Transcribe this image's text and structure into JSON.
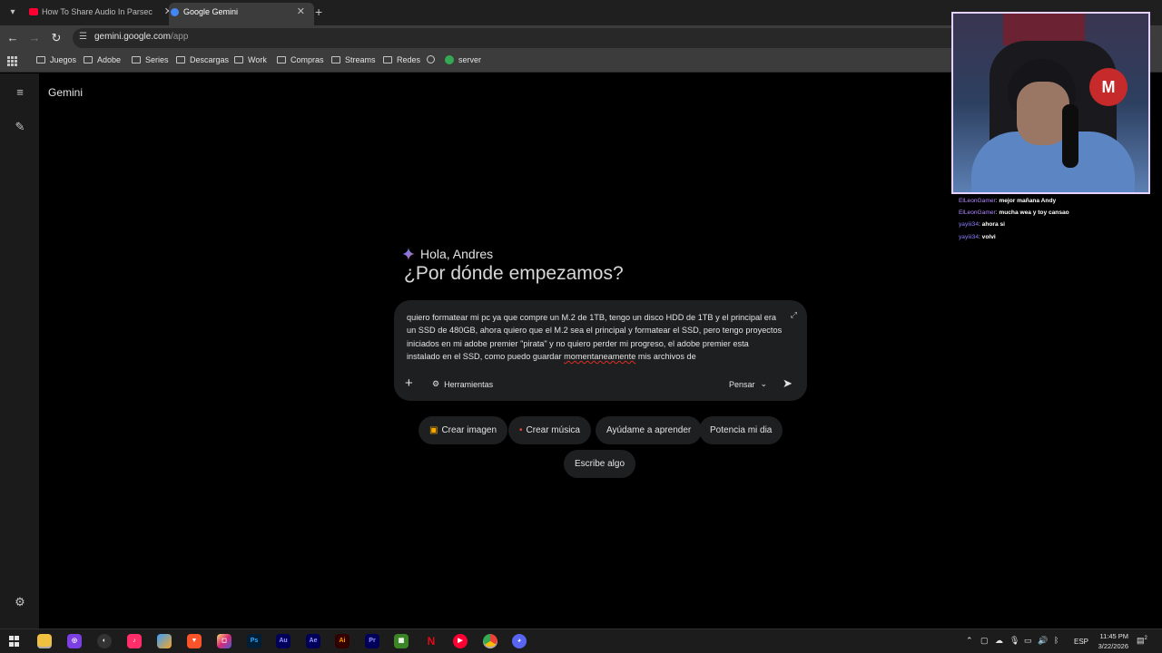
{
  "browser": {
    "tabs": [
      {
        "title": "How To Share Audio In Parsec",
        "favicon_color": "#ff0033",
        "active": false
      },
      {
        "title": "Google Gemini",
        "favicon_color": "#4285f4",
        "active": true
      }
    ],
    "address": {
      "host": "gemini.google.com",
      "path": "/app"
    },
    "bookmarks": [
      "Juegos",
      "Adobe",
      "Series",
      "Descargas",
      "Work",
      "Compras",
      "Streams",
      "Redes",
      "",
      "server"
    ]
  },
  "gemini": {
    "app_name": "Gemini",
    "greeting": "Hola, Andres",
    "headline": "¿Por dónde empezamos?",
    "prompt": {
      "text_before": "quiero formatear mi pc ya que compre un M.2 de 1TB, tengo un disco HDD de 1TB y el principal era un SSD de 480GB, ahora quiero que el M.2 sea el principal y formatear el SSD, pero tengo proyectos iniciados en mi adobe premier \"pirata\" y no quiero perder mi progreso, el adobe premier esta instalado en el SSD, como puedo guardar ",
      "misspelled": "momentaneamente",
      "text_after": " mis archivos de",
      "tools_label": "Herramientas",
      "mode_label": "Pensar"
    },
    "chips": [
      {
        "label": "Crear imagen",
        "icon": "image-icon"
      },
      {
        "label": "Crear música",
        "icon": "music-icon"
      },
      {
        "label": "Ayúdame a aprender",
        "icon": ""
      },
      {
        "label": "Potencia mi dia",
        "icon": ""
      },
      {
        "label": "Escribe algo",
        "icon": ""
      }
    ]
  },
  "stream_chat": [
    {
      "user": "ElLeonGamer",
      "message": "mejor mañana Andy"
    },
    {
      "user": "ElLeonGamer",
      "message": "mucha wea y toy cansao"
    },
    {
      "user": "yayiii34",
      "message": "ahora si"
    },
    {
      "user": "yayiii34",
      "message": "volvi"
    }
  ],
  "webcam_overlay": {
    "cap_letter": "M"
  },
  "taskbar": {
    "apps": [
      "file-explorer-icon",
      "camera-app-icon",
      "obs-icon",
      "tiktok-icon",
      "copilot-icon",
      "brave-icon",
      "instagram-icon",
      "photoshop-icon",
      "audition-icon",
      "after-effects-icon",
      "illustrator-icon",
      "premiere-icon",
      "minecraft-icon",
      "netflix-icon",
      "youtube-music-icon",
      "chrome-icon",
      "discord-icon"
    ],
    "app_labels": {
      "photoshop": "Ps",
      "audition": "Au",
      "after_effects": "Ae",
      "illustrator": "Ai",
      "premiere": "Pr"
    },
    "language": "ESP",
    "time": "11:45 PM",
    "date": "3/22/2026",
    "notifications": "2"
  }
}
